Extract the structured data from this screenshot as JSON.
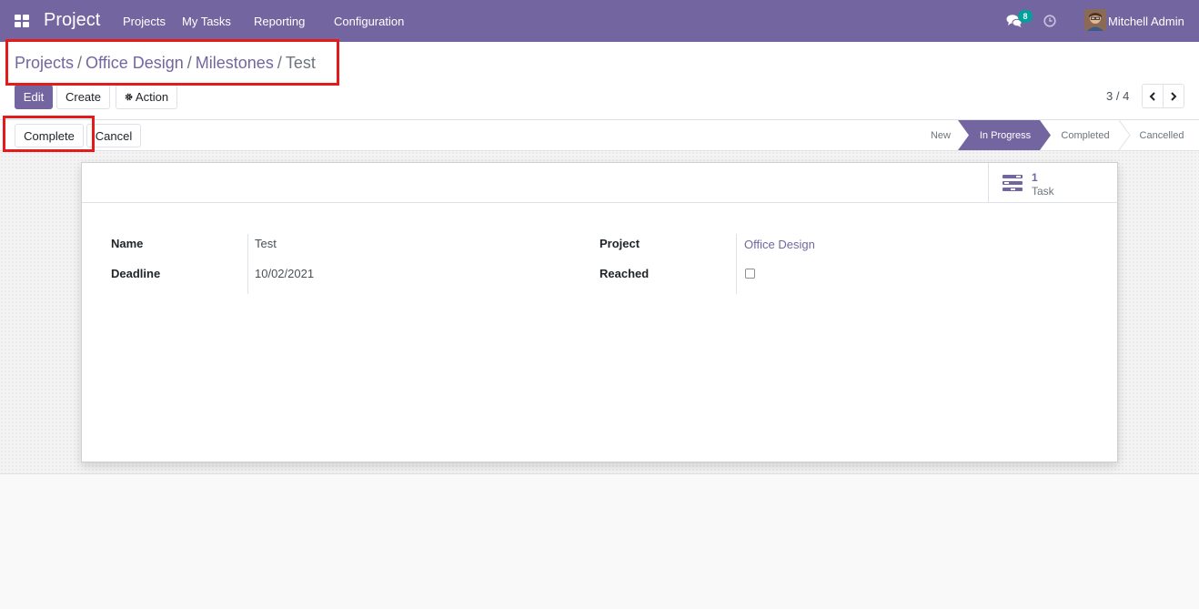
{
  "navbar": {
    "app_name": "Project",
    "menu": [
      "Projects",
      "My Tasks",
      "Reporting",
      "Configuration"
    ],
    "chat_count": "8",
    "user_name": "Mitchell Admin",
    "color": "#7366a0"
  },
  "breadcrumb": {
    "items": [
      "Projects",
      "Office Design",
      "Milestones"
    ],
    "separator": "/",
    "current": "Test"
  },
  "toolbar": {
    "edit_label": "Edit",
    "create_label": "Create",
    "action_label": "Action"
  },
  "pager": {
    "value": "3 / 4"
  },
  "statusbar": {
    "complete_label": "Complete",
    "cancel_label": "Cancel",
    "stages": [
      "New",
      "In Progress",
      "Completed",
      "Cancelled"
    ],
    "active_stage": "In Progress"
  },
  "smart_button": {
    "value": "1",
    "label": "Task",
    "icon": "tasks-icon"
  },
  "form": {
    "name_label": "Name",
    "name_value": "Test",
    "deadline_label": "Deadline",
    "deadline_value": "10/02/2021",
    "project_label": "Project",
    "project_value": "Office Design",
    "reached_label": "Reached",
    "reached_value": false
  },
  "colors": {
    "accent": "#7366a0",
    "highlight": "#e41b1b"
  }
}
